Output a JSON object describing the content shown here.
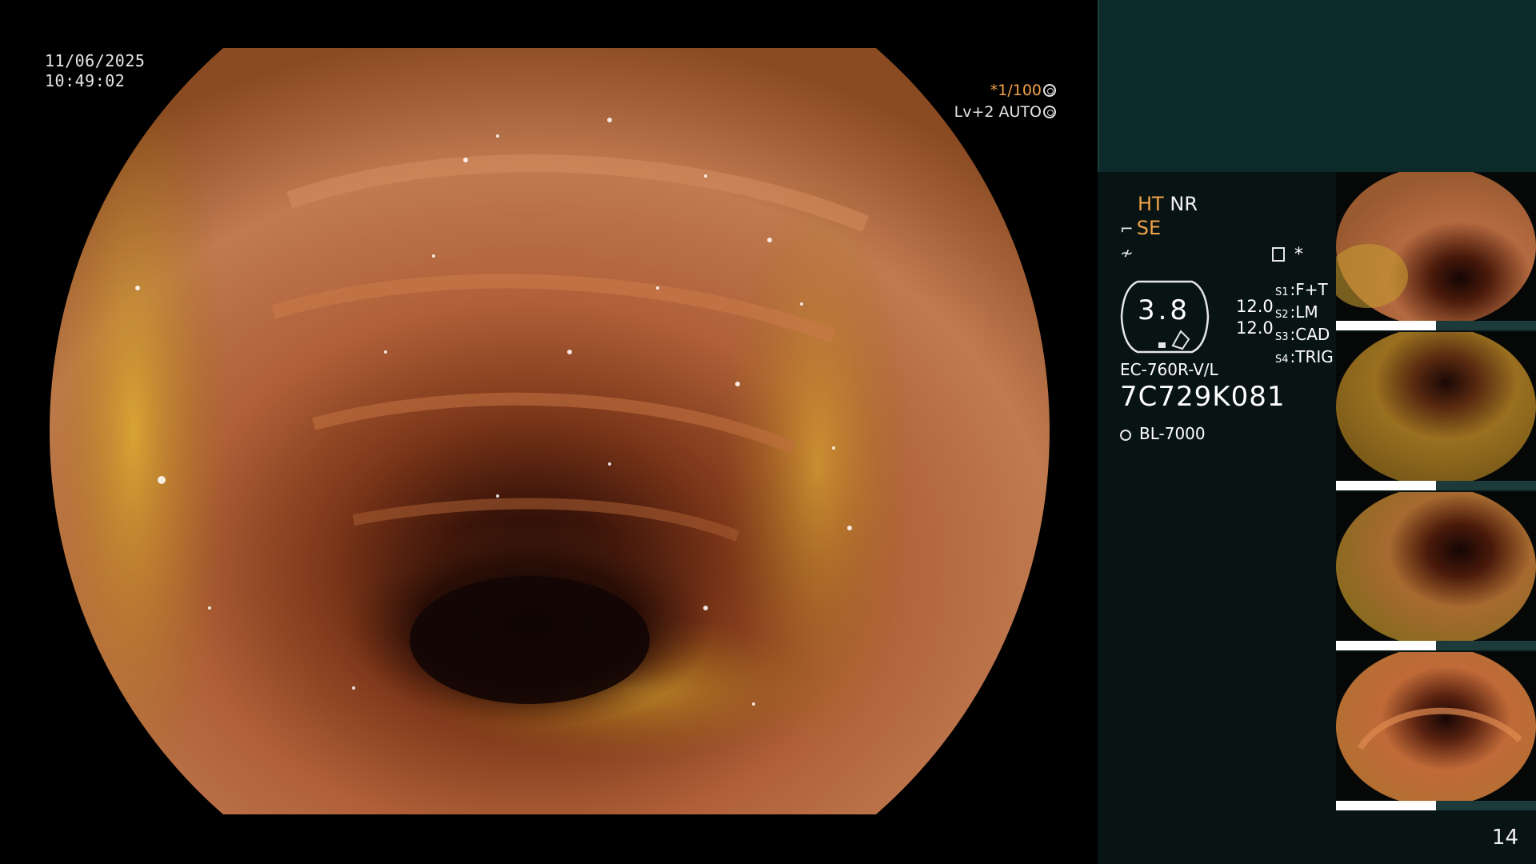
{
  "overlay": {
    "date": "11/06/2025",
    "time": "10:49:02",
    "shutter": "*1/100",
    "level": "Lv+2 AUTO"
  },
  "panel": {
    "mode1a": "HT",
    "mode1b": "NR",
    "mode2": "SE",
    "asterisk": "*",
    "gauge_value": "3.8",
    "gauge_top": "12.0",
    "gauge_bottom": "12.0",
    "switches": [
      {
        "key": "S1",
        "value": "F+T"
      },
      {
        "key": "S2",
        "value": "LM"
      },
      {
        "key": "S3",
        "value": "CAD"
      },
      {
        "key": "S4",
        "value": "TRIG"
      }
    ],
    "scope_model": "EC-760R-V/L",
    "scope_serial": "7C729K081",
    "light_source": "BL-7000"
  },
  "page_number": "14",
  "colors": {
    "accent": "#f0a24a",
    "panel_top": "#0c2a29",
    "panel": "#081413"
  }
}
